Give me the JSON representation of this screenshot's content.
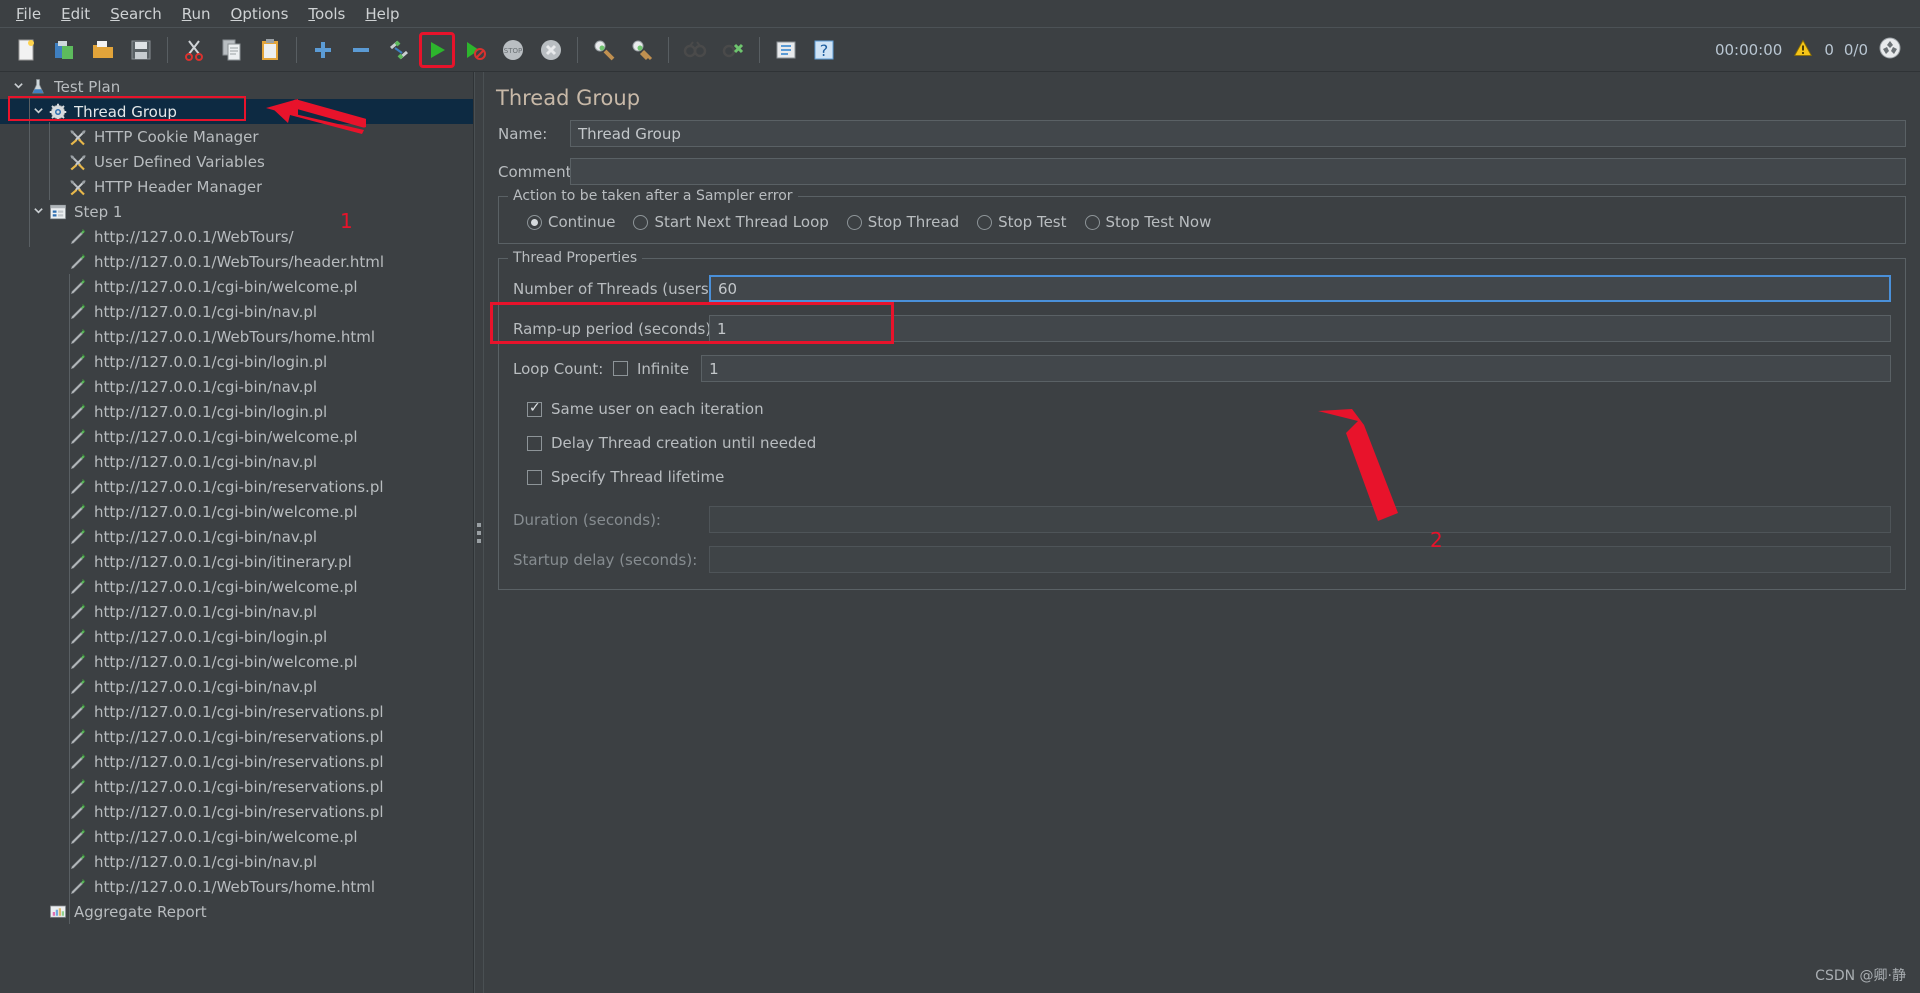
{
  "menubar": {
    "items": [
      {
        "label": "File",
        "mnemonic": "F"
      },
      {
        "label": "Edit",
        "mnemonic": "E"
      },
      {
        "label": "Search",
        "mnemonic": "S"
      },
      {
        "label": "Run",
        "mnemonic": "R"
      },
      {
        "label": "Options",
        "mnemonic": "O"
      },
      {
        "label": "Tools",
        "mnemonic": "T"
      },
      {
        "label": "Help",
        "mnemonic": "H"
      }
    ]
  },
  "toolbar": {
    "buttons": [
      {
        "name": "new-icon",
        "title": "New"
      },
      {
        "name": "templates-icon",
        "title": "Templates"
      },
      {
        "name": "open-icon",
        "title": "Open"
      },
      {
        "name": "save-icon",
        "title": "Save Test Plan"
      },
      {
        "name": "cut-icon",
        "title": "Cut"
      },
      {
        "name": "copy-icon",
        "title": "Copy"
      },
      {
        "name": "paste-icon",
        "title": "Paste"
      },
      {
        "name": "expand-all-icon",
        "title": "Expand All"
      },
      {
        "name": "collapse-all-icon",
        "title": "Collapse All"
      },
      {
        "name": "toggle-icon",
        "title": "Toggle"
      },
      {
        "name": "start-icon",
        "title": "Start"
      },
      {
        "name": "start-no-timers-icon",
        "title": "Start no pauses"
      },
      {
        "name": "stop-icon",
        "title": "Stop"
      },
      {
        "name": "shutdown-icon",
        "title": "Shutdown"
      },
      {
        "name": "clear-icon",
        "title": "Clear"
      },
      {
        "name": "clear-all-icon",
        "title": "Clear All"
      },
      {
        "name": "search-icon",
        "title": "Search"
      },
      {
        "name": "reset-search-icon",
        "title": "Reset Search"
      },
      {
        "name": "function-helper-icon",
        "title": "Function Helper Dialog"
      },
      {
        "name": "help-icon",
        "title": "Help"
      }
    ],
    "status": {
      "timer": "00:00:00",
      "warning_count": "0",
      "threads": "0/0"
    }
  },
  "tree": {
    "nodes": [
      {
        "label": "Test Plan",
        "icon": "test-plan-icon",
        "depth": 0,
        "twist": "down",
        "selected": false
      },
      {
        "label": "Thread Group",
        "icon": "thread-group-icon",
        "depth": 1,
        "twist": "down",
        "selected": true
      },
      {
        "label": "HTTP Cookie Manager",
        "icon": "config-element-icon",
        "depth": 2,
        "twist": "",
        "selected": false
      },
      {
        "label": "User Defined Variables",
        "icon": "config-element-icon",
        "depth": 2,
        "twist": "",
        "selected": false
      },
      {
        "label": "HTTP Header Manager",
        "icon": "config-element-icon",
        "depth": 2,
        "twist": "",
        "selected": false
      },
      {
        "label": "Step 1",
        "icon": "transaction-controller-icon",
        "depth": 1,
        "twist": "down",
        "selected": false
      },
      {
        "label": "http://127.0.0.1/WebTours/",
        "icon": "http-request-icon",
        "depth": 2,
        "twist": "",
        "selected": false
      },
      {
        "label": "http://127.0.0.1/WebTours/header.html",
        "icon": "http-request-icon",
        "depth": 2,
        "twist": "",
        "selected": false
      },
      {
        "label": "http://127.0.0.1/cgi-bin/welcome.pl",
        "icon": "http-request-icon",
        "depth": 2,
        "twist": "",
        "selected": false
      },
      {
        "label": "http://127.0.0.1/cgi-bin/nav.pl",
        "icon": "http-request-icon",
        "depth": 2,
        "twist": "",
        "selected": false
      },
      {
        "label": "http://127.0.0.1/WebTours/home.html",
        "icon": "http-request-icon",
        "depth": 2,
        "twist": "",
        "selected": false
      },
      {
        "label": "http://127.0.0.1/cgi-bin/login.pl",
        "icon": "http-request-icon",
        "depth": 2,
        "twist": "",
        "selected": false
      },
      {
        "label": "http://127.0.0.1/cgi-bin/nav.pl",
        "icon": "http-request-icon",
        "depth": 2,
        "twist": "",
        "selected": false
      },
      {
        "label": "http://127.0.0.1/cgi-bin/login.pl",
        "icon": "http-request-icon",
        "depth": 2,
        "twist": "",
        "selected": false
      },
      {
        "label": "http://127.0.0.1/cgi-bin/welcome.pl",
        "icon": "http-request-icon",
        "depth": 2,
        "twist": "",
        "selected": false
      },
      {
        "label": "http://127.0.0.1/cgi-bin/nav.pl",
        "icon": "http-request-icon",
        "depth": 2,
        "twist": "",
        "selected": false
      },
      {
        "label": "http://127.0.0.1/cgi-bin/reservations.pl",
        "icon": "http-request-icon",
        "depth": 2,
        "twist": "",
        "selected": false
      },
      {
        "label": "http://127.0.0.1/cgi-bin/welcome.pl",
        "icon": "http-request-icon",
        "depth": 2,
        "twist": "",
        "selected": false
      },
      {
        "label": "http://127.0.0.1/cgi-bin/nav.pl",
        "icon": "http-request-icon",
        "depth": 2,
        "twist": "",
        "selected": false
      },
      {
        "label": "http://127.0.0.1/cgi-bin/itinerary.pl",
        "icon": "http-request-icon",
        "depth": 2,
        "twist": "",
        "selected": false
      },
      {
        "label": "http://127.0.0.1/cgi-bin/welcome.pl",
        "icon": "http-request-icon",
        "depth": 2,
        "twist": "",
        "selected": false
      },
      {
        "label": "http://127.0.0.1/cgi-bin/nav.pl",
        "icon": "http-request-icon",
        "depth": 2,
        "twist": "",
        "selected": false
      },
      {
        "label": "http://127.0.0.1/cgi-bin/login.pl",
        "icon": "http-request-icon",
        "depth": 2,
        "twist": "",
        "selected": false
      },
      {
        "label": "http://127.0.0.1/cgi-bin/welcome.pl",
        "icon": "http-request-icon",
        "depth": 2,
        "twist": "",
        "selected": false
      },
      {
        "label": "http://127.0.0.1/cgi-bin/nav.pl",
        "icon": "http-request-icon",
        "depth": 2,
        "twist": "",
        "selected": false
      },
      {
        "label": "http://127.0.0.1/cgi-bin/reservations.pl",
        "icon": "http-request-icon",
        "depth": 2,
        "twist": "",
        "selected": false
      },
      {
        "label": "http://127.0.0.1/cgi-bin/reservations.pl",
        "icon": "http-request-icon",
        "depth": 2,
        "twist": "",
        "selected": false
      },
      {
        "label": "http://127.0.0.1/cgi-bin/reservations.pl",
        "icon": "http-request-icon",
        "depth": 2,
        "twist": "",
        "selected": false
      },
      {
        "label": "http://127.0.0.1/cgi-bin/reservations.pl",
        "icon": "http-request-icon",
        "depth": 2,
        "twist": "",
        "selected": false
      },
      {
        "label": "http://127.0.0.1/cgi-bin/reservations.pl",
        "icon": "http-request-icon",
        "depth": 2,
        "twist": "",
        "selected": false
      },
      {
        "label": "http://127.0.0.1/cgi-bin/welcome.pl",
        "icon": "http-request-icon",
        "depth": 2,
        "twist": "",
        "selected": false
      },
      {
        "label": "http://127.0.0.1/cgi-bin/nav.pl",
        "icon": "http-request-icon",
        "depth": 2,
        "twist": "",
        "selected": false
      },
      {
        "label": "http://127.0.0.1/WebTours/home.html",
        "icon": "http-request-icon",
        "depth": 2,
        "twist": "",
        "selected": false
      },
      {
        "label": "Aggregate Report",
        "icon": "aggregate-report-icon",
        "depth": 1,
        "twist": "",
        "selected": false
      }
    ]
  },
  "panel": {
    "title": "Thread Group",
    "name_label": "Name:",
    "name_value": "Thread Group",
    "comments_label": "Comments:",
    "comments_value": "",
    "sampler_error": {
      "legend": "Action to be taken after a Sampler error",
      "options": [
        {
          "label": "Continue",
          "selected": true
        },
        {
          "label": "Start Next Thread Loop",
          "selected": false
        },
        {
          "label": "Stop Thread",
          "selected": false
        },
        {
          "label": "Stop Test",
          "selected": false
        },
        {
          "label": "Stop Test Now",
          "selected": false
        }
      ]
    },
    "thread_properties": {
      "legend": "Thread Properties",
      "num_threads_label": "Number of Threads (users):",
      "num_threads_value": "60",
      "rampup_label": "Ramp-up period (seconds):",
      "rampup_value": "1",
      "loop_count_label": "Loop Count:",
      "infinite_label": "Infinite",
      "infinite_checked": false,
      "loop_count_value": "1",
      "same_user_label": "Same user on each iteration",
      "same_user_checked": true,
      "delay_thread_label": "Delay Thread creation until needed",
      "delay_thread_checked": false,
      "specify_lifetime_label": "Specify Thread lifetime",
      "specify_lifetime_checked": false,
      "duration_label": "Duration (seconds):",
      "duration_value": "",
      "startup_delay_label": "Startup delay (seconds):",
      "startup_delay_value": ""
    }
  },
  "annotations": {
    "marker_1": "1",
    "marker_2": "2",
    "accent_color": "#e8132b"
  },
  "watermark": "CSDN @卿·静"
}
